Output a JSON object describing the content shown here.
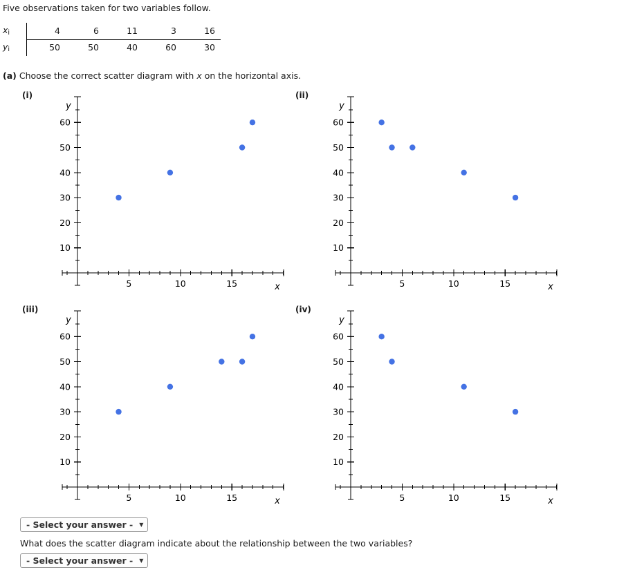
{
  "intro": "Five observations taken for two variables follow.",
  "table": {
    "row_labels": [
      "x",
      "y"
    ],
    "subscript": "i",
    "x_values": [
      "4",
      "6",
      "11",
      "3",
      "16"
    ],
    "y_values": [
      "50",
      "50",
      "40",
      "60",
      "30"
    ]
  },
  "part_a": {
    "marker": "(a)",
    "text_before": "Choose the correct scatter diagram with ",
    "var": "x",
    "text_after": " on the horizontal axis."
  },
  "axes": {
    "x_label": "x",
    "y_label": "y",
    "x_ticks": [
      "5",
      "10",
      "15"
    ],
    "x_tick_values": [
      5,
      10,
      15
    ],
    "y_ticks": [
      "10",
      "20",
      "30",
      "40",
      "50",
      "60"
    ],
    "y_tick_values": [
      10,
      20,
      30,
      40,
      50,
      60
    ],
    "x_range": [
      -1,
      20
    ],
    "y_range": [
      0,
      68
    ]
  },
  "point_color": "#4472E4",
  "panels": [
    {
      "label": "(i)",
      "chart_data": {
        "type": "scatter",
        "title": "(i)",
        "xlabel": "x",
        "ylabel": "y",
        "xlim": [
          -1,
          20
        ],
        "ylim": [
          0,
          68
        ],
        "x": [
          4,
          9,
          16,
          17
        ],
        "y": [
          30,
          40,
          50,
          60
        ],
        "points": [
          [
            4,
            30
          ],
          [
            9,
            40
          ],
          [
            16,
            50
          ],
          [
            17,
            60
          ]
        ],
        "grid": false,
        "legend": "none"
      }
    },
    {
      "label": "(ii)",
      "chart_data": {
        "type": "scatter",
        "title": "(ii)",
        "xlabel": "x",
        "ylabel": "y",
        "xlim": [
          -1,
          20
        ],
        "ylim": [
          0,
          68
        ],
        "x": [
          3,
          4,
          6,
          11,
          16
        ],
        "y": [
          60,
          50,
          50,
          40,
          30
        ],
        "points": [
          [
            3,
            60
          ],
          [
            4,
            50
          ],
          [
            6,
            50
          ],
          [
            11,
            40
          ],
          [
            16,
            30
          ]
        ],
        "grid": false,
        "legend": "none"
      }
    },
    {
      "label": "(iii)",
      "chart_data": {
        "type": "scatter",
        "title": "(iii)",
        "xlabel": "x",
        "ylabel": "y",
        "xlim": [
          -1,
          20
        ],
        "ylim": [
          0,
          68
        ],
        "x": [
          4,
          9,
          14,
          16,
          17
        ],
        "y": [
          30,
          40,
          50,
          50,
          60
        ],
        "points": [
          [
            4,
            30
          ],
          [
            9,
            40
          ],
          [
            14,
            50
          ],
          [
            16,
            50
          ],
          [
            17,
            60
          ]
        ],
        "grid": false,
        "legend": "none"
      }
    },
    {
      "label": "(iv)",
      "chart_data": {
        "type": "scatter",
        "title": "(iv)",
        "xlabel": "x",
        "ylabel": "y",
        "xlim": [
          -1,
          20
        ],
        "ylim": [
          0,
          68
        ],
        "x": [
          3,
          4,
          11,
          16
        ],
        "y": [
          60,
          50,
          40,
          30
        ],
        "points": [
          [
            3,
            60
          ],
          [
            4,
            50
          ],
          [
            11,
            40
          ],
          [
            16,
            30
          ]
        ],
        "grid": false,
        "legend": "none"
      }
    }
  ],
  "select_diagram": {
    "value": "- Select your answer -",
    "caret": "▼"
  },
  "question_b": "What does the scatter diagram indicate about the relationship between the two variables?",
  "select_relationship": {
    "value": "- Select your answer -",
    "caret": "▼"
  }
}
